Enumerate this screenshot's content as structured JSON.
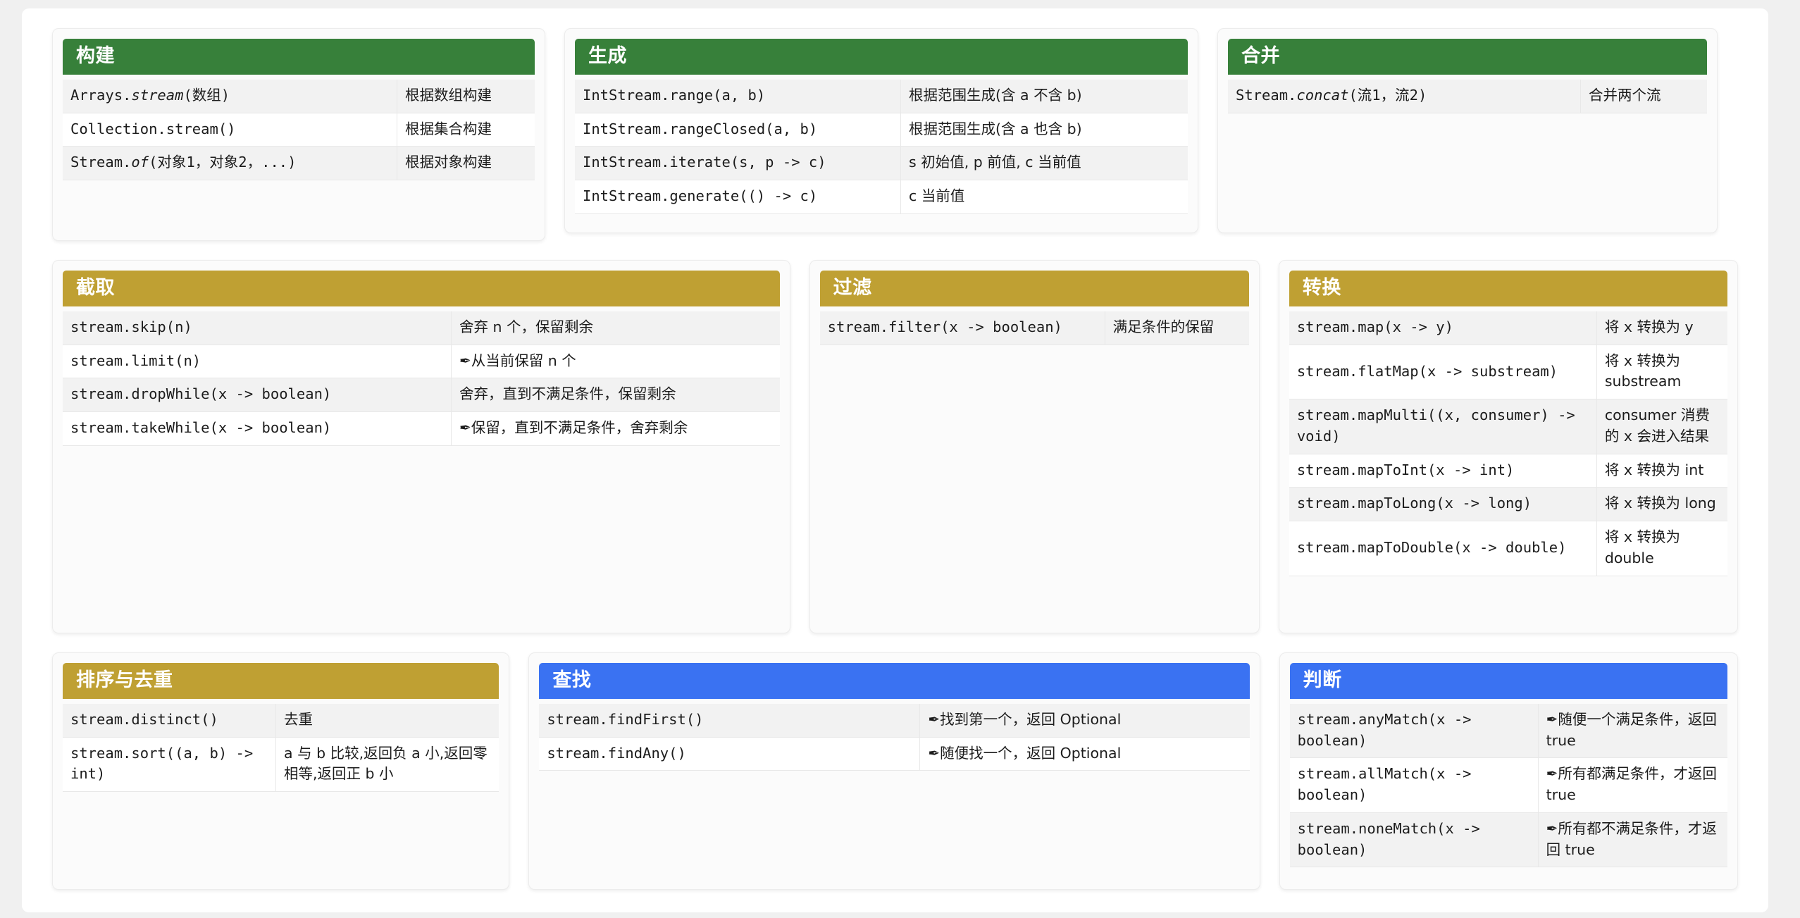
{
  "icons": {
    "nib": "✒"
  },
  "colors": {
    "green": "#37803a",
    "gold": "#bfa033",
    "blue": "#3a72f2",
    "page_bg": "#f0f0f0",
    "container_bg": "#ffffff",
    "card_bg": "#fbfbfb",
    "row_stripe": "#f2f2f2",
    "row_plain": "#ffffff"
  },
  "cards": {
    "build": {
      "title": "构建",
      "rows": [
        {
          "sig_pre": "Arrays.",
          "sig_em": "stream",
          "sig_post": "(数组)",
          "desc": "根据数组构建"
        },
        {
          "sig_pre": "Collection.stream()",
          "sig_em": "",
          "sig_post": "",
          "desc": "根据集合构建"
        },
        {
          "sig_pre": "Stream.",
          "sig_em": "of",
          "sig_post": "(对象1，对象2，...)",
          "desc": "根据对象构建"
        }
      ]
    },
    "generate": {
      "title": "生成",
      "rows": [
        {
          "sig": "IntStream.range(a, b)",
          "desc": "根据范围生成(含 a 不含 b)"
        },
        {
          "sig": "IntStream.rangeClosed(a, b)",
          "desc": "根据范围生成(含 a 也含 b)"
        },
        {
          "sig": "IntStream.iterate(s, p -> c)",
          "desc": "s 初始值, p 前值, c 当前值"
        },
        {
          "sig": "IntStream.generate(() -> c)",
          "desc": "c 当前值"
        }
      ]
    },
    "merge": {
      "title": "合并",
      "rows": [
        {
          "sig_pre": "Stream.",
          "sig_em": "concat",
          "sig_post": "(流1，流2)",
          "desc": "合并两个流"
        }
      ]
    },
    "truncate": {
      "title": "截取",
      "rows": [
        {
          "sig": "stream.skip(n)",
          "nib": false,
          "desc": "舍弃 n 个，保留剩余"
        },
        {
          "sig": "stream.limit(n)",
          "nib": true,
          "desc": "从当前保留 n 个"
        },
        {
          "sig": "stream.dropWhile(x -> boolean)",
          "nib": false,
          "desc": "舍弃，直到不满足条件，保留剩余"
        },
        {
          "sig": "stream.takeWhile(x -> boolean)",
          "nib": true,
          "desc": "保留，直到不满足条件，舍弃剩余"
        }
      ]
    },
    "filter": {
      "title": "过滤",
      "rows": [
        {
          "sig": "stream.filter(x -> boolean)",
          "nib": false,
          "desc": "满足条件的保留"
        }
      ]
    },
    "transform": {
      "title": "转换",
      "rows": [
        {
          "sig": "stream.map(x -> y)",
          "desc": "将 x 转换为 y"
        },
        {
          "sig": "stream.flatMap(x -> substream)",
          "desc": "将 x 转换为 substream"
        },
        {
          "sig": "stream.mapMulti((x, consumer) -> void)",
          "desc": "consumer 消费的 x 会进入结果"
        },
        {
          "sig": "stream.mapToInt(x -> int)",
          "desc": "将 x 转换为 int"
        },
        {
          "sig": "stream.mapToLong(x -> long)",
          "desc": "将 x 转换为 long"
        },
        {
          "sig": "stream.mapToDouble(x -> double)",
          "desc": "将 x 转换为 double"
        }
      ]
    },
    "sort": {
      "title": "排序与去重",
      "rows": [
        {
          "sig": "stream.distinct()",
          "desc": "去重"
        },
        {
          "sig": "stream.sort((a, b) -> int)",
          "desc": "a 与 b 比较,返回负 a 小,返回零相等,返回正 b 小"
        }
      ]
    },
    "find": {
      "title": "查找",
      "rows": [
        {
          "sig": "stream.findFirst()",
          "nib": true,
          "desc": "找到第一个，返回 Optional"
        },
        {
          "sig": "stream.findAny()",
          "nib": true,
          "desc": "随便找一个，返回 Optional"
        }
      ]
    },
    "judge": {
      "title": "判断",
      "rows": [
        {
          "sig": "stream.anyMatch(x -> boolean)",
          "nib": true,
          "desc": "随便一个满足条件，返回 true"
        },
        {
          "sig": "stream.allMatch(x -> boolean)",
          "nib": true,
          "desc": "所有都满足条件，才返回 true"
        },
        {
          "sig": "stream.noneMatch(x -> boolean)",
          "nib": true,
          "desc": "所有都不满足条件，才返回 true"
        }
      ]
    }
  }
}
